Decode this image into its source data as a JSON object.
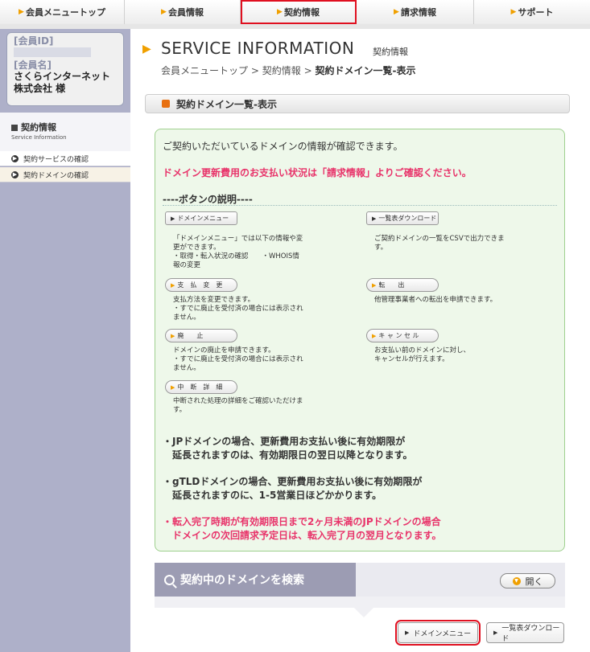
{
  "topnav": {
    "items": [
      {
        "label": "会員メニュートップ"
      },
      {
        "label": "会員情報"
      },
      {
        "label": "契約情報"
      },
      {
        "label": "請求情報"
      },
      {
        "label": "サポート"
      }
    ],
    "active_index": 2
  },
  "member": {
    "id_label": "[会員ID]",
    "name_label": "[会員名]",
    "name_line1": "さくらインターネット",
    "name_line2": "株式会社 様"
  },
  "sidebar": {
    "section_title": "契約情報",
    "section_subtitle": "Service Information",
    "items": [
      {
        "label": "契約サービスの確認"
      },
      {
        "label": "契約ドメインの確認"
      }
    ]
  },
  "header": {
    "title": "SERVICE INFORMATION",
    "subtitle": "契約情報",
    "breadcrumb_1": "会員メニュートップ",
    "breadcrumb_2": "契約情報",
    "breadcrumb_3": "契約ドメイン一覧-表示",
    "separator": ">"
  },
  "section": {
    "title": "契約ドメイン一覧-表示"
  },
  "info": {
    "intro": "ご契約いただいているドメインの情報が確認できます。",
    "warning": "ドメイン更新費用のお支払い状況は「請求情報」よりご確認ください。",
    "buttons_heading": "----ボタンの説明----",
    "btn_domain_menu": "ドメインメニュー",
    "desc_domain_menu_1": "「ドメインメニュー」では以下の情報や変",
    "desc_domain_menu_2": "更ができます。",
    "desc_domain_menu_3": "・取得・転入状況の確認　　・WHOIS情",
    "desc_domain_menu_4": "報の変更",
    "btn_list_download": "一覧表ダウンロード",
    "desc_list_download_1": "ご契約ドメインの一覧をCSVで出力できま",
    "desc_list_download_2": "す。",
    "btn_payment_change": "支　払　変　更",
    "desc_payment_change_1": "支払方法を変更できます。",
    "desc_payment_change_2": "・すでに廃止を受付済の場合には表示され",
    "desc_payment_change_3": "ません。",
    "btn_transfer_out": "転　　出",
    "desc_transfer_out_1": "他管理事業者への転出を申請できます。",
    "btn_abolish": "廃　　止",
    "desc_abolish_1": "ドメインの廃止を申請できます。",
    "desc_abolish_2": "・すでに廃止を受付済の場合には表示され",
    "desc_abolish_3": "ません。",
    "btn_cancel": "キ ャ ン セ ル",
    "desc_cancel_1": "お支払い前のドメインに対し、",
    "desc_cancel_2": "キャンセルが行えます。",
    "btn_suspend_detail": "中　断　詳　細",
    "desc_suspend_detail_1": "中断された処理の詳細をご確認いただけま",
    "desc_suspend_detail_2": "す。",
    "note_jp_1": "・JPドメインの場合、更新費用お支払い後に有効期限が",
    "note_jp_2": "　延長されますのは、有効期限日の翌日以降となります。",
    "note_gtld_1": "・gTLDドメインの場合、更新費用お支払い後に有効期限が",
    "note_gtld_2": "　延長されますのに、1-5営業日ほどかかります。",
    "note_transfer_1": "・転入完了時期が有効期限日まで2ヶ月未満のJPドメインの場合",
    "note_transfer_2": "　ドメインの次回請求予定日は、転入完了月の翌月となります。"
  },
  "search": {
    "label": "契約中のドメインを検索",
    "open_label": "開く"
  },
  "bottom": {
    "domain_menu_label": "ドメインメニュー",
    "list_download_label": "一覧表ダウンロード"
  }
}
